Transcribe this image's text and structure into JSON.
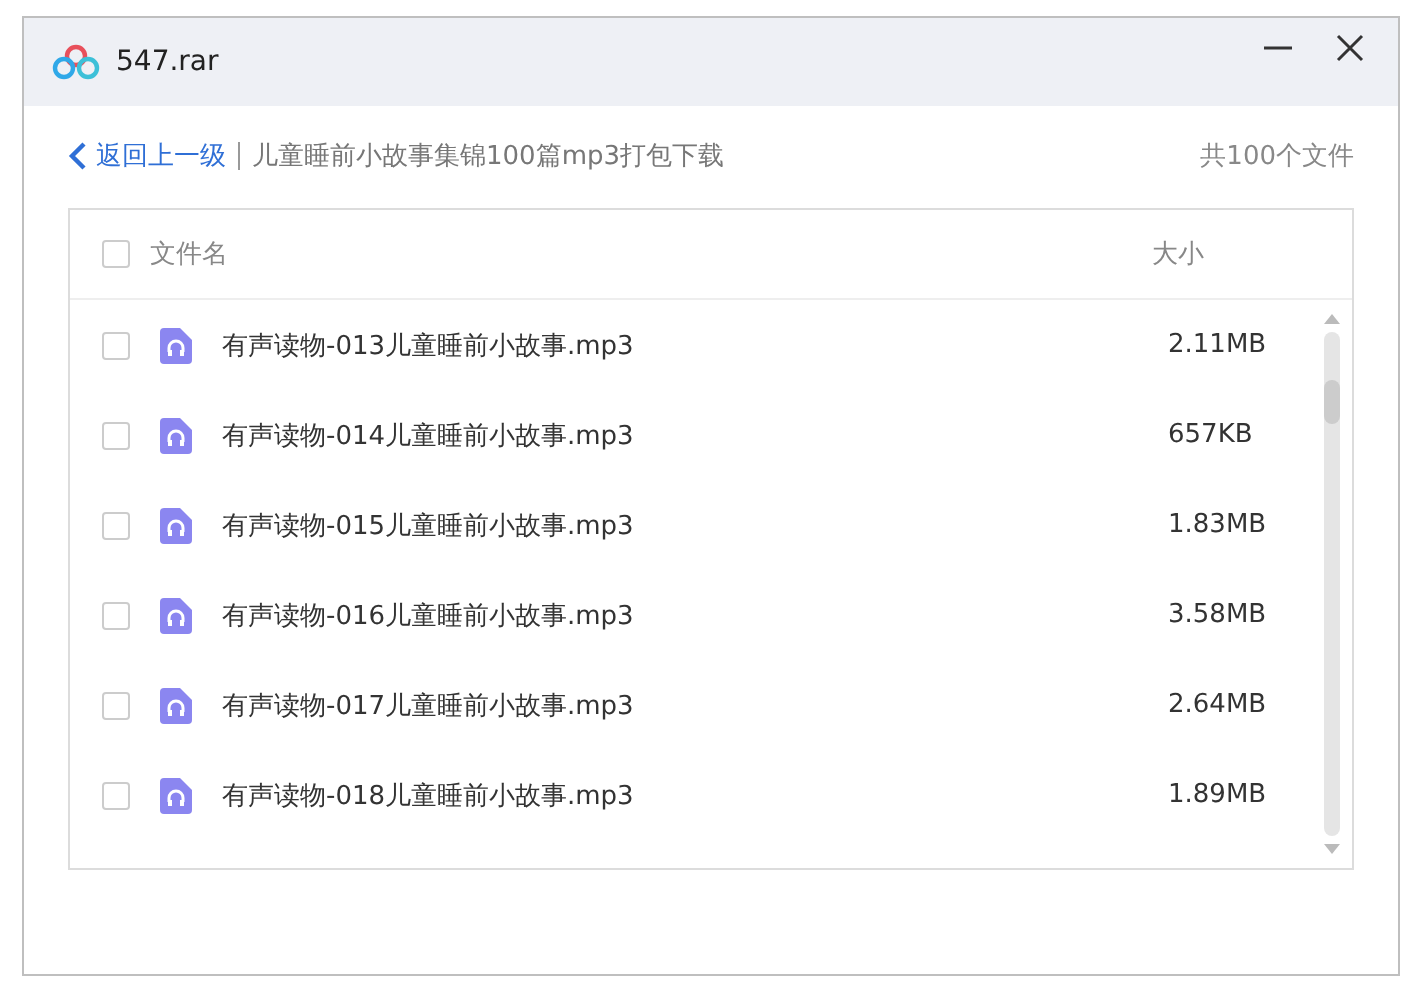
{
  "window": {
    "title": "547.rar"
  },
  "nav": {
    "back": "返回上一级",
    "path": "儿童睡前小故事集锦100篇mp3打包下载",
    "count": "共100个文件"
  },
  "table": {
    "columns": [
      "文件名",
      "大小"
    ],
    "all_checked": false,
    "rows": [
      {
        "name": "有声读物-013儿童睡前小故事.mp3",
        "size": "2.11MB",
        "checked": false
      },
      {
        "name": "有声读物-014儿童睡前小故事.mp3",
        "size": "657KB",
        "checked": false
      },
      {
        "name": "有声读物-015儿童睡前小故事.mp3",
        "size": "1.83MB",
        "checked": false
      },
      {
        "name": "有声读物-016儿童睡前小故事.mp3",
        "size": "3.58MB",
        "checked": false
      },
      {
        "name": "有声读物-017儿童睡前小故事.mp3",
        "size": "2.64MB",
        "checked": false
      },
      {
        "name": "有声读物-018儿童睡前小故事.mp3",
        "size": "1.89MB",
        "checked": false
      }
    ]
  }
}
